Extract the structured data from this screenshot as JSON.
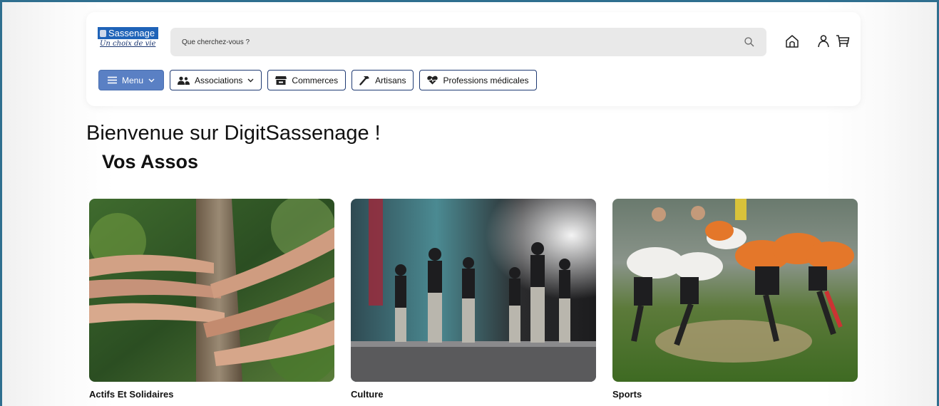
{
  "logo": {
    "name": "Sassenage",
    "tagline": "Un choix de vie"
  },
  "search": {
    "placeholder": "Que cherchez-vous ?"
  },
  "header_icons": [
    "home-icon",
    "user-icon",
    "cart-icon"
  ],
  "nav": {
    "menu": "Menu",
    "associations": "Associations",
    "commerces": "Commerces",
    "artisans": "Artisans",
    "medical": "Professions médicales"
  },
  "main": {
    "welcome": "Bienvenue sur DigitSassenage !",
    "section_title": "Vos Assos"
  },
  "categories": [
    {
      "label": "Actifs Et Solidaires",
      "image": "hands-on-tree-photo"
    },
    {
      "label": "Culture",
      "image": "dancers-on-stage-photo"
    },
    {
      "label": "Sports",
      "image": "rugby-scrum-photo"
    }
  ],
  "colors": {
    "menu_button": "#5a80c4",
    "button_border": "#1f3a73",
    "logo_blue": "#1f63b8",
    "search_bg": "#e9e9e9",
    "frame_border": "#2f6f8f"
  }
}
